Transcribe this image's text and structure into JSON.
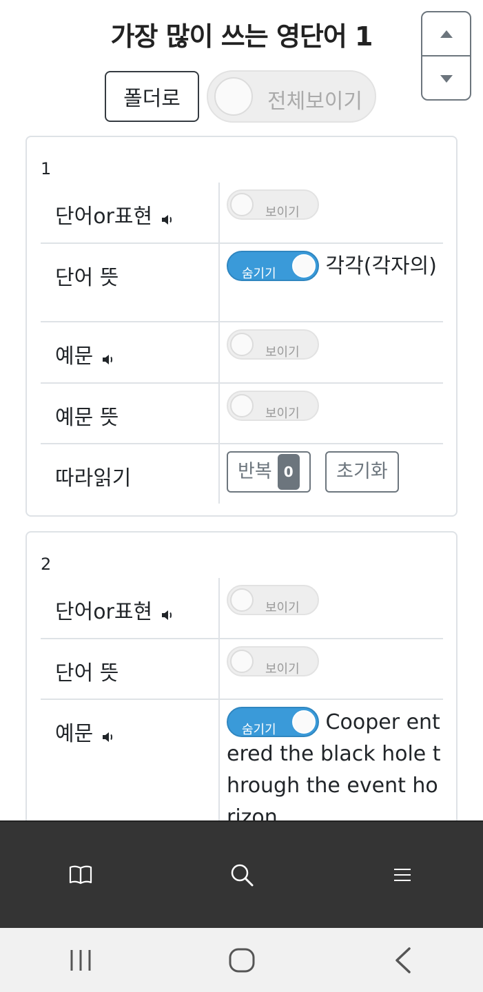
{
  "header": {
    "title": "가장 많이 쓰는 영단어 1",
    "folder_button": "폴더로",
    "show_all_toggle": "전체보이기"
  },
  "scroll_control": {
    "up_icon": "triangle-up-icon",
    "down_icon": "triangle-down-icon"
  },
  "labels": {
    "word": "단어or표현",
    "meaning": "단어 뜻",
    "example": "예문",
    "example_meaning": "예문 뜻",
    "follow_read": "따라읽기",
    "show": "보이기",
    "hide": "숨기기",
    "repeat": "반복",
    "reset": "초기화"
  },
  "cards": [
    {
      "number": "1",
      "meaning_text": "각각(각자의)",
      "repeat_count": "0"
    },
    {
      "number": "2",
      "example_text": "Cooper entered the black hole through the event horizon."
    }
  ],
  "bottom_nav": [
    "book-icon",
    "search-icon",
    "menu-icon"
  ],
  "system_nav": [
    "recent-apps-icon",
    "home-icon",
    "back-icon"
  ],
  "colors": {
    "toggle_on": "#3a9ad9",
    "bottom_bar": "#343434",
    "system_bar": "#f1f1f1"
  }
}
